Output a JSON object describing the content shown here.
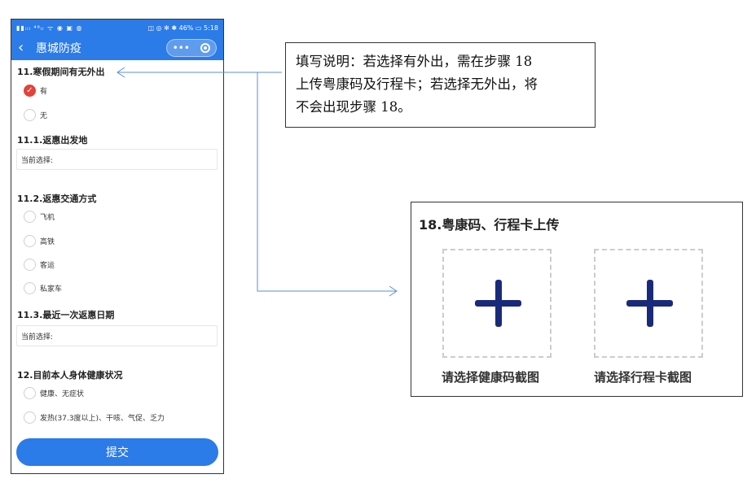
{
  "status_bar": {
    "left_icons": "▮▮ᵢₗₗ ⁴⁶ₗₗ ᯤ ◉ ▣ ◍",
    "right_text": "◫ ◎ ✻ ✱ 46% ▭ 5:18"
  },
  "nav": {
    "title": "惠城防疫",
    "more_glyph": "•••"
  },
  "form": {
    "q11": {
      "label": "11.寒假期间有无外出",
      "options": [
        "有",
        "无"
      ],
      "selected": "有"
    },
    "q11_1": {
      "label": "11.1.返惠出发地",
      "field_text": "当前选择:"
    },
    "q11_2": {
      "label": "11.2.返惠交通方式",
      "options": [
        "飞机",
        "高铁",
        "客运",
        "私家车"
      ]
    },
    "q11_3": {
      "label": "11.3.最近一次返惠日期",
      "field_text": "当前选择:"
    },
    "q12": {
      "label": "12.目前本人身体健康状况",
      "options": [
        "健康、无症状",
        "发热(37.3度以上)、干咳、气促、乏力"
      ]
    },
    "next_label_cut": "1",
    "submit_label": "提交"
  },
  "note": {
    "line1": "填写说明：若选择有外出，需在步骤 18",
    "line2": "上传粤康码及行程卡；若选择无外出，将",
    "line3": "不会出现步骤 18。"
  },
  "upload_panel": {
    "title": "18.粤康码、行程卡上传",
    "health_code_label": "请选择健康码截图",
    "itinerary_label": "请选择行程卡截图"
  },
  "colors": {
    "primary_blue": "#2b7be8",
    "checked_red": "#e5423a",
    "plus_navy": "#1a2a7a",
    "connector": "#5b8fd6"
  }
}
